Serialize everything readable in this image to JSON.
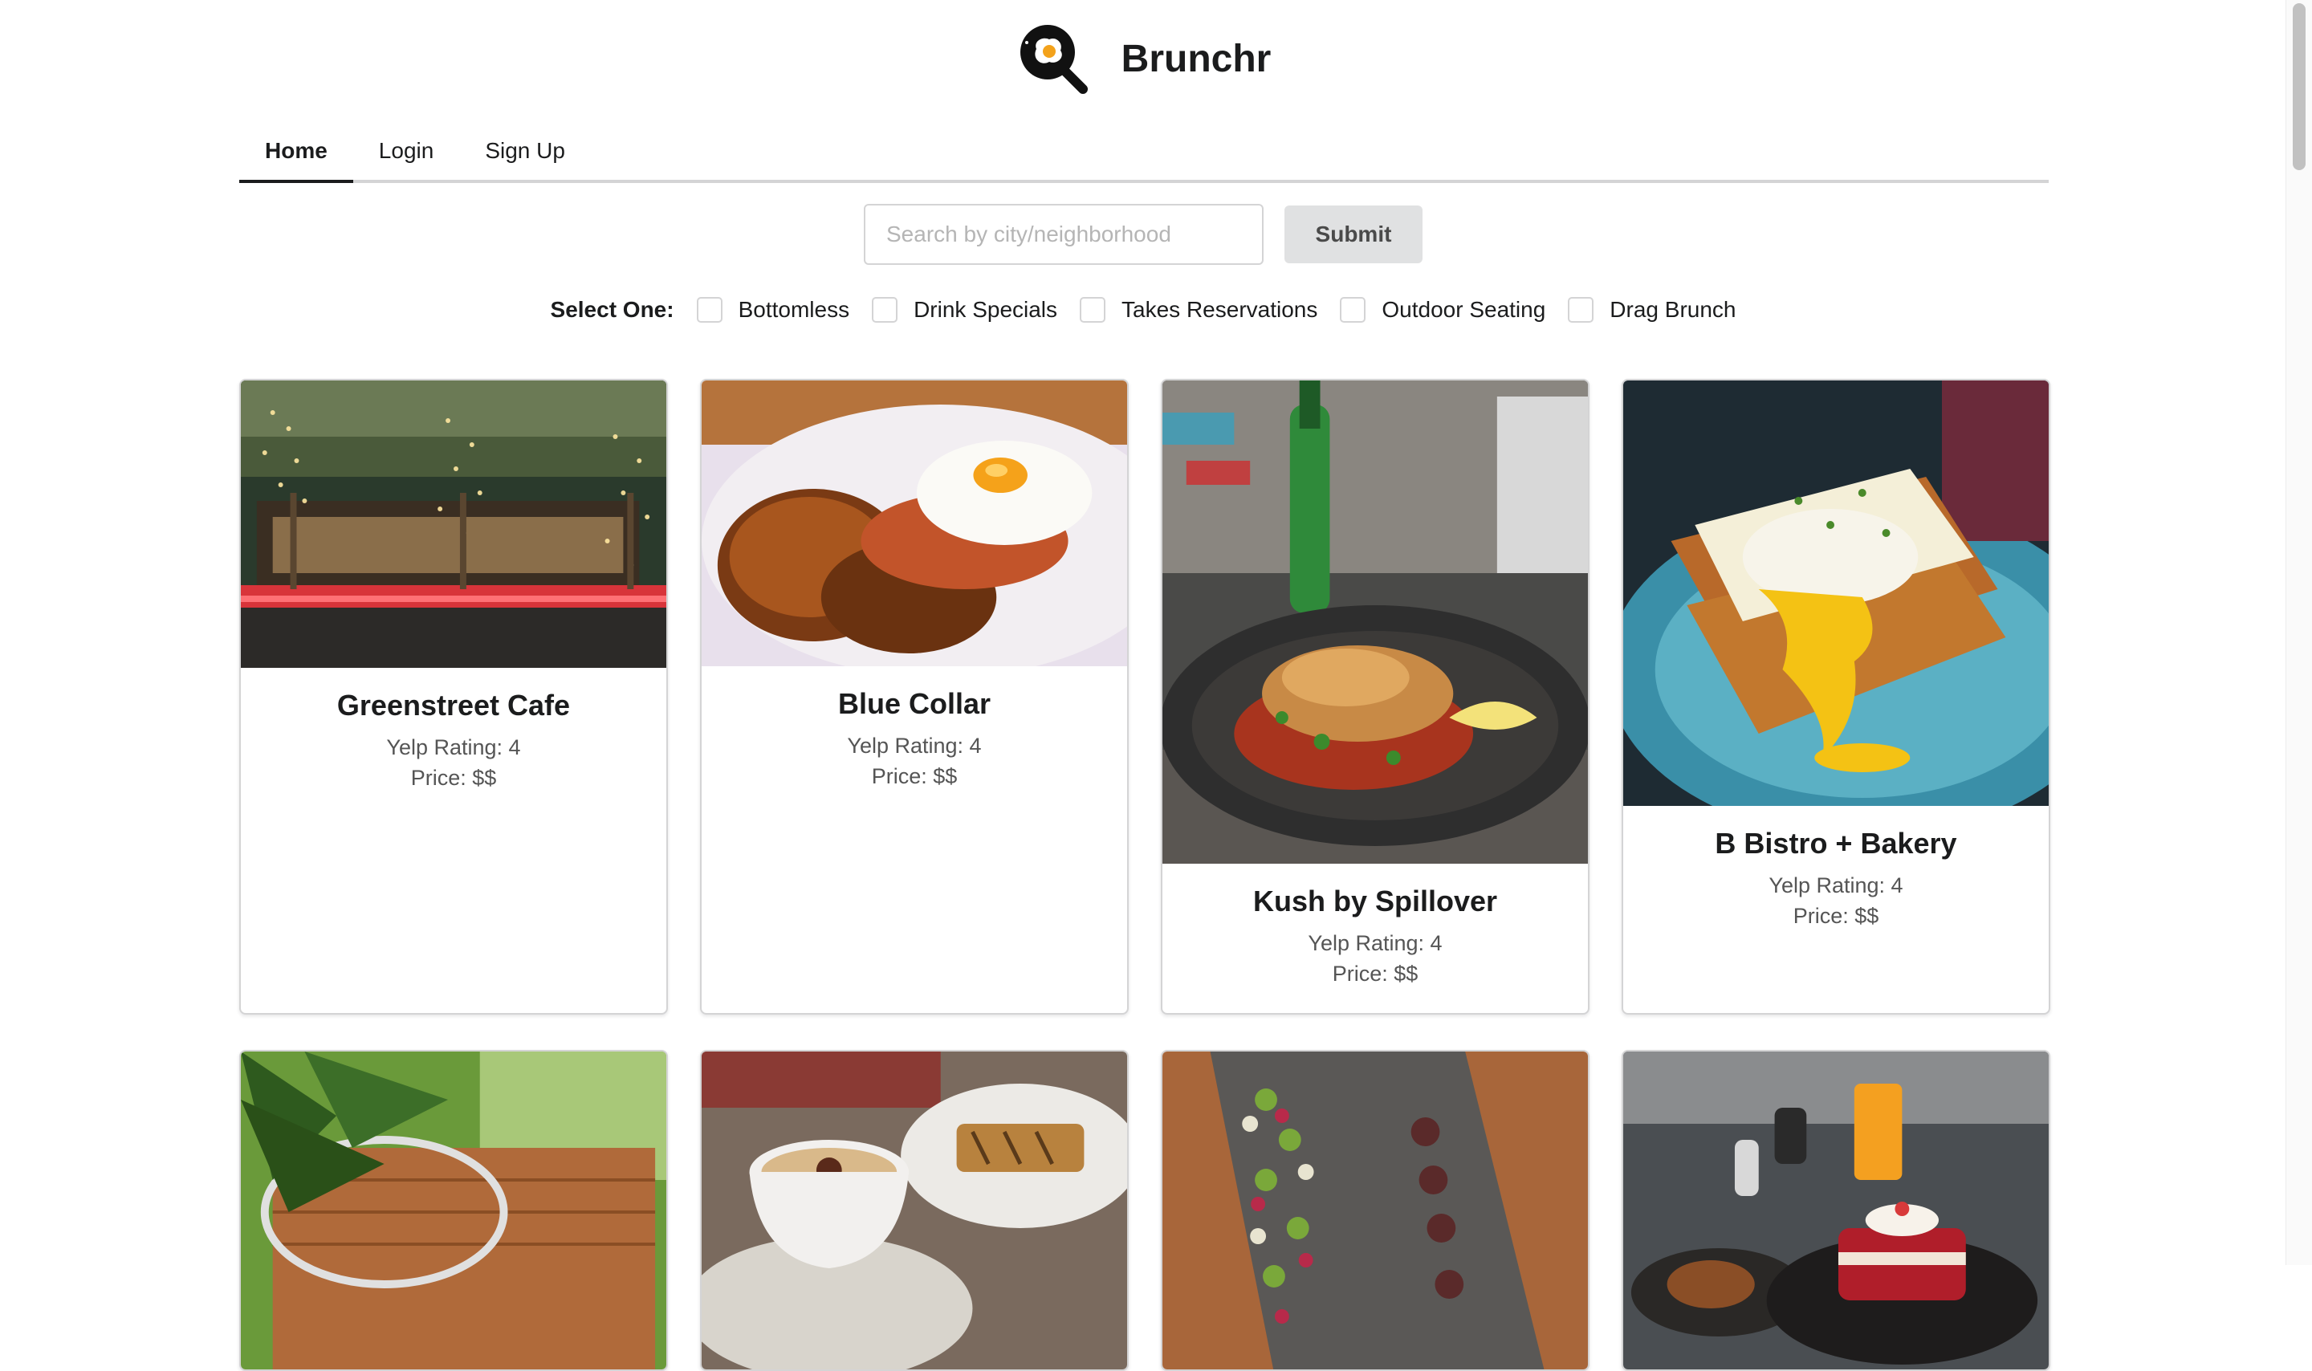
{
  "app": {
    "name": "Brunchr",
    "logo_icon": "magnifier-egg-icon"
  },
  "tabs": [
    {
      "label": "Home",
      "active": true
    },
    {
      "label": "Login",
      "active": false
    },
    {
      "label": "Sign Up",
      "active": false
    }
  ],
  "search": {
    "placeholder": "Search by city/neighborhood",
    "value": "",
    "submit_label": "Submit"
  },
  "filters": {
    "label": "Select One:",
    "options": [
      {
        "label": "Bottomless",
        "checked": false
      },
      {
        "label": "Drink Specials",
        "checked": false
      },
      {
        "label": "Takes Reservations",
        "checked": false
      },
      {
        "label": "Outdoor Seating",
        "checked": false
      },
      {
        "label": "Drag Brunch",
        "checked": false
      }
    ]
  },
  "restaurants": [
    {
      "name": "Greenstreet Cafe",
      "rating": "Yelp Rating: 4",
      "price": "Price: $$",
      "image": "outdoor-patio-photo"
    },
    {
      "name": "Blue Collar",
      "rating": "Yelp Rating: 4",
      "price": "Price: $$",
      "image": "fried-egg-toast-photo"
    },
    {
      "name": "Kush by Spillover",
      "rating": "Yelp Rating: 4",
      "price": "Price: $$",
      "image": "crispy-fish-plate-photo"
    },
    {
      "name": "B Bistro + Bakery",
      "rating": "Yelp Rating: 4",
      "price": "Price: $$",
      "image": "egg-toast-stack-photo"
    },
    {
      "name": "",
      "rating": "",
      "price": "",
      "image": "tropical-garden-photo"
    },
    {
      "name": "",
      "rating": "",
      "price": "",
      "image": "coffee-and-panini-photo"
    },
    {
      "name": "",
      "rating": "",
      "price": "",
      "image": "slate-platter-photo"
    },
    {
      "name": "",
      "rating": "",
      "price": "",
      "image": "red-velvet-pancakes-photo"
    }
  ]
}
